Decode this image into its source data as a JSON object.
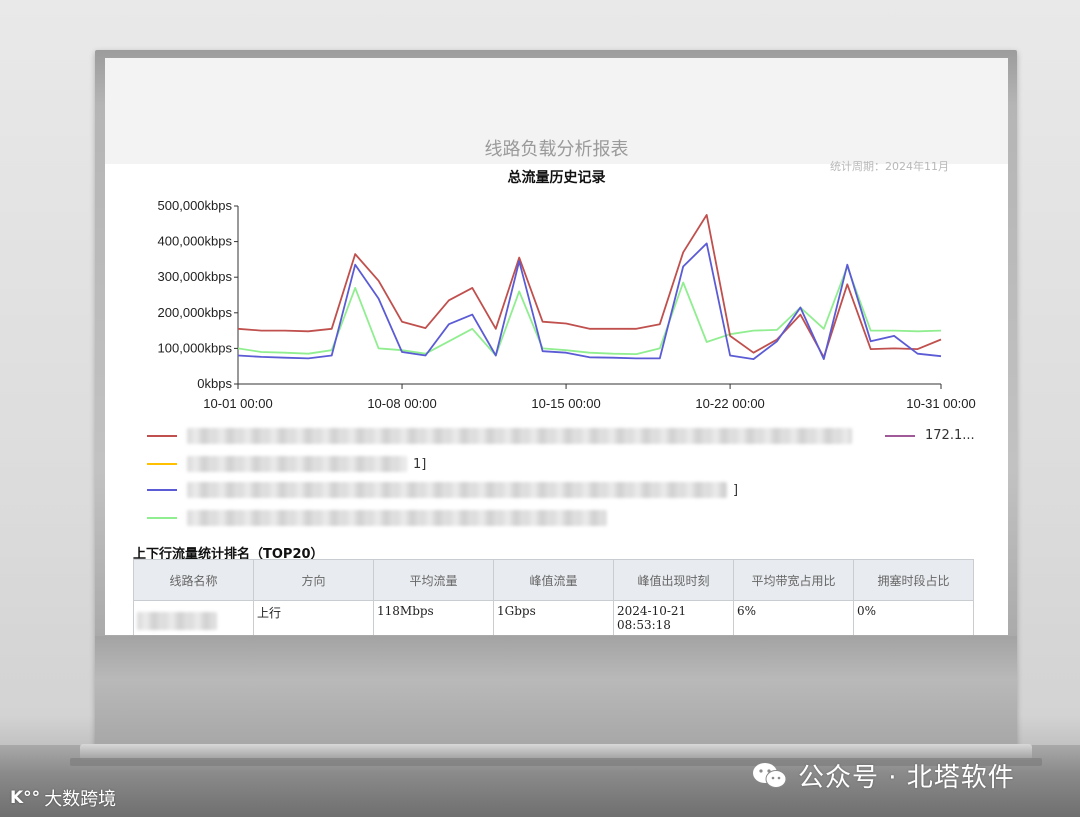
{
  "report": {
    "title": "线路负载分析报表",
    "stat_period": "统计周期：2024年11月"
  },
  "chart_data": {
    "type": "line",
    "title": "总流量历史记录",
    "ylim": [
      0,
      500000
    ],
    "yticks": [
      "0kbps",
      "100,000kbps",
      "200,000kbps",
      "300,000kbps",
      "400,000kbps",
      "500,000kbps"
    ],
    "xticks": [
      "10-01 00:00",
      "10-08 00:00",
      "10-15 00:00",
      "10-22 00:00",
      "10-31 00:00"
    ],
    "x": [
      1,
      2,
      3,
      4,
      5,
      6,
      7,
      8,
      9,
      10,
      11,
      12,
      13,
      14,
      15,
      16,
      17,
      18,
      19,
      20,
      21,
      22,
      23,
      24,
      25,
      26,
      27,
      28,
      29,
      30,
      31,
      32
    ],
    "series": [
      {
        "color": "#c0504d",
        "values": [
          155000,
          150000,
          150000,
          148000,
          155000,
          365000,
          290000,
          175000,
          157000,
          235000,
          270000,
          155000,
          355000,
          175000,
          170000,
          155000,
          155000,
          155000,
          168000,
          370000,
          475000,
          135000,
          88000,
          125000,
          195000,
          75000,
          280000,
          98000,
          100000,
          98000,
          125000
        ]
      },
      {
        "color": "#ffc000",
        "values": []
      },
      {
        "color": "#5b5bd6",
        "values": [
          80000,
          76000,
          74000,
          72000,
          80000,
          335000,
          240000,
          90000,
          80000,
          168000,
          195000,
          80000,
          345000,
          92000,
          88000,
          75000,
          74000,
          72000,
          72000,
          330000,
          395000,
          80000,
          70000,
          120000,
          215000,
          70000,
          335000,
          120000,
          135000,
          85000,
          78000
        ]
      },
      {
        "color": "#90ee90",
        "values": [
          100000,
          90000,
          88000,
          85000,
          95000,
          270000,
          100000,
          95000,
          85000,
          120000,
          155000,
          80000,
          260000,
          100000,
          95000,
          88000,
          85000,
          84000,
          100000,
          285000,
          118000,
          140000,
          150000,
          152000,
          215000,
          155000,
          330000,
          150000,
          150000,
          148000,
          150000
        ]
      }
    ]
  },
  "legend": {
    "items": [
      {
        "color": "#c0504d",
        "label": "",
        "tail": ""
      },
      {
        "color": "#ffc000",
        "label": "",
        "tail": "1]"
      },
      {
        "color": "#5b5bd6",
        "label": "",
        "tail": "]"
      },
      {
        "color": "#90ee90",
        "label": "",
        "tail": ""
      }
    ],
    "right_item": {
      "color": "#a05a9a",
      "label": "172.1..."
    }
  },
  "ranking": {
    "title": "上下行流量统计排名（TOP20）",
    "headers": [
      "线路名称",
      "方向",
      "平均流量",
      "峰值流量",
      "峰值出现时刻",
      "平均带宽占用比",
      "拥塞时段占比"
    ],
    "row": {
      "direction": "上行",
      "avg": "118Mbps",
      "peak": "1Gbps",
      "peak_time": "2024-10-21 08:53:18",
      "avg_ratio": "6%",
      "congestion": "0%"
    }
  },
  "watermarks": {
    "right": "公众号 · 北塔软件",
    "left_logo": "K°°",
    "left_text": "大数跨境"
  }
}
